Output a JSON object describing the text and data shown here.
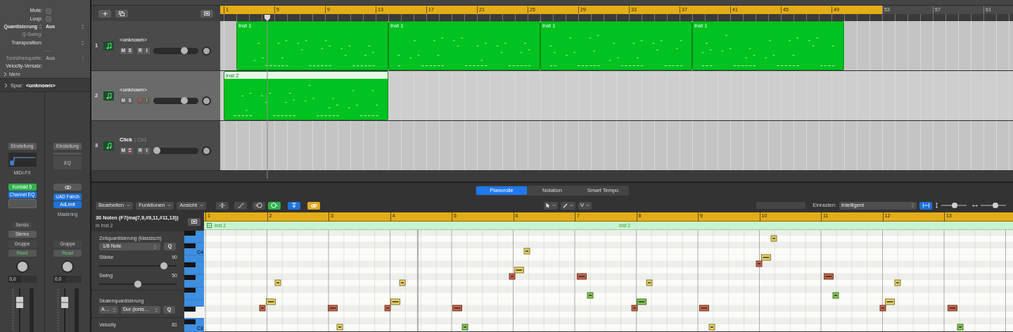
{
  "inspector": {
    "rows": [
      {
        "kind": "checkbox",
        "label": "Mute:",
        "checked": false,
        "disabled": false
      },
      {
        "kind": "checkbox",
        "label": "Loop:",
        "checked": false,
        "disabled": false
      },
      {
        "kind": "stepper",
        "label": "Quantisierung",
        "inline_stepper": true,
        "value": "Aus",
        "disabled": false
      },
      {
        "kind": "field",
        "label": "Q-Swing:",
        "disabled": true
      },
      {
        "kind": "stepper",
        "label": "Transposition:",
        "disabled": false
      },
      {
        "kind": "field",
        "value": "- -",
        "disabled": true
      },
      {
        "kind": "stepper",
        "label": "Tonhöhenquelle:",
        "value": "Aus",
        "disabled": true
      },
      {
        "kind": "field",
        "label": "Velocity-Versatz:",
        "disabled": false
      }
    ],
    "more": "Mehr",
    "track_label": "Spur:",
    "track_name": "<unknown>"
  },
  "channel_strips": [
    {
      "setting": "Einstellung",
      "insert": {
        "kind": "midi_fx",
        "label": "MIDI-FX"
      },
      "link": false,
      "slots": [
        {
          "label": "Kontakt 5",
          "kind": "instrument"
        },
        {
          "label": "Channel EQ",
          "kind": "effect"
        }
      ],
      "empty_slot": true,
      "sends": "Sends",
      "output": "Stereo",
      "group": "Gruppe",
      "automation": "Read",
      "volume": "0,0"
    },
    {
      "setting": "Einstellung",
      "insert": {
        "kind": "eq",
        "label": "EQ"
      },
      "link": true,
      "slots": [
        {
          "label": "UAD Fairch",
          "kind": "effect"
        },
        {
          "label": "AdLimit",
          "kind": "effect"
        }
      ],
      "empty_slot": false,
      "name": "Mastering",
      "group": "Gruppe",
      "automation": "Read",
      "volume": "0,0"
    }
  ],
  "ruler": {
    "marks": [
      {
        "label": "1",
        "in_cycle": true
      },
      {
        "label": "5",
        "in_cycle": true
      },
      {
        "label": "9",
        "in_cycle": true
      },
      {
        "label": "13",
        "in_cycle": true
      },
      {
        "label": "17",
        "in_cycle": true
      },
      {
        "label": "21",
        "in_cycle": true
      },
      {
        "label": "25",
        "in_cycle": true
      },
      {
        "label": "29",
        "in_cycle": true
      },
      {
        "label": "33",
        "in_cycle": true
      },
      {
        "label": "37",
        "in_cycle": true
      },
      {
        "label": "41",
        "in_cycle": true
      },
      {
        "label": "45",
        "in_cycle": true
      },
      {
        "label": "49",
        "in_cycle": true
      },
      {
        "label": "53",
        "in_cycle": false
      },
      {
        "label": "57",
        "in_cycle": false
      },
      {
        "label": "61",
        "in_cycle": false
      }
    ]
  },
  "tracks": [
    {
      "number": "1",
      "name": "<unknown>",
      "selected": false,
      "level": 0.72,
      "buttons": [
        {
          "label": "M",
          "kind": "mute",
          "on": false
        },
        {
          "label": "S",
          "kind": "solo",
          "on": false
        },
        {
          "label": "R",
          "kind": "record",
          "on": false
        },
        {
          "label": "I",
          "kind": "input",
          "on": false
        }
      ],
      "regions": [
        {
          "name": "Inst 1",
          "selected": false
        },
        {
          "name": "Inst 1",
          "selected": false
        },
        {
          "name": "Inst 1",
          "selected": false
        },
        {
          "name": "Inst 1",
          "selected": false
        }
      ]
    },
    {
      "number": "2",
      "name": "<unknown>",
      "selected": true,
      "level": 0.72,
      "buttons": [
        {
          "label": "M",
          "kind": "mute",
          "on": false
        },
        {
          "label": "S",
          "kind": "solo",
          "on": false
        },
        {
          "label": "R",
          "kind": "record",
          "on": true
        },
        {
          "label": "I",
          "kind": "input",
          "on": true
        }
      ],
      "regions": [
        {
          "name": "Inst 2",
          "selected": true
        }
      ]
    },
    {
      "number": "3",
      "name": "Click",
      "channel": "| Ch1",
      "selected": false,
      "level": 0,
      "buttons": [
        {
          "label": "M",
          "kind": "mute",
          "on": false
        },
        {
          "label": "S",
          "kind": "solo_safe",
          "on": true
        },
        {
          "label": "R",
          "kind": "record",
          "on": false
        },
        {
          "label": "I",
          "kind": "input",
          "on": false
        }
      ]
    }
  ],
  "editor": {
    "tabs": [
      {
        "label": "Pianorolle",
        "selected": true
      },
      {
        "label": "Notation",
        "selected": false
      },
      {
        "label": "Smart Tempo",
        "selected": false
      }
    ],
    "menus": [
      "Bearbeiten",
      "Funktionen",
      "Ansicht"
    ],
    "tool_menus": [
      {
        "kind": "pointer"
      },
      {
        "kind": "pencil"
      },
      {
        "kind": "text",
        "label": "V"
      }
    ],
    "snap_label": "Einrasten:",
    "snap_value": "Intelligent",
    "zoom_sliders": [
      {
        "level": 0.55
      },
      {
        "level": 0.6
      }
    ],
    "selection": {
      "title": "30 Noten (F7(maj7,9,#9,11,#11,13))",
      "region": "in Inst 2"
    },
    "time_quantize": {
      "title": "Zeitquantisierung (klassisch)",
      "value": "1/8 Note",
      "button": "Q",
      "sliders": [
        {
          "label": "Stärke",
          "reading": "90",
          "level": 0.87
        },
        {
          "label": "Swing",
          "reading": "50",
          "level": 0.5
        }
      ]
    },
    "scale_quantize": {
      "title": "Skalenquantisierung",
      "root": "A…",
      "scale": "Dur (ionis…",
      "button": "Q"
    },
    "velocity": {
      "label": "Velocity",
      "reading": "81"
    },
    "keyboard_labels": [
      "C4",
      "C3"
    ],
    "ruler": [
      "1",
      "2",
      "3",
      "4",
      "5",
      "6",
      "7",
      "8",
      "9",
      "10",
      "11",
      "12",
      "13"
    ],
    "region_labels": [
      "Inst 2",
      "Inst 2"
    ]
  }
}
